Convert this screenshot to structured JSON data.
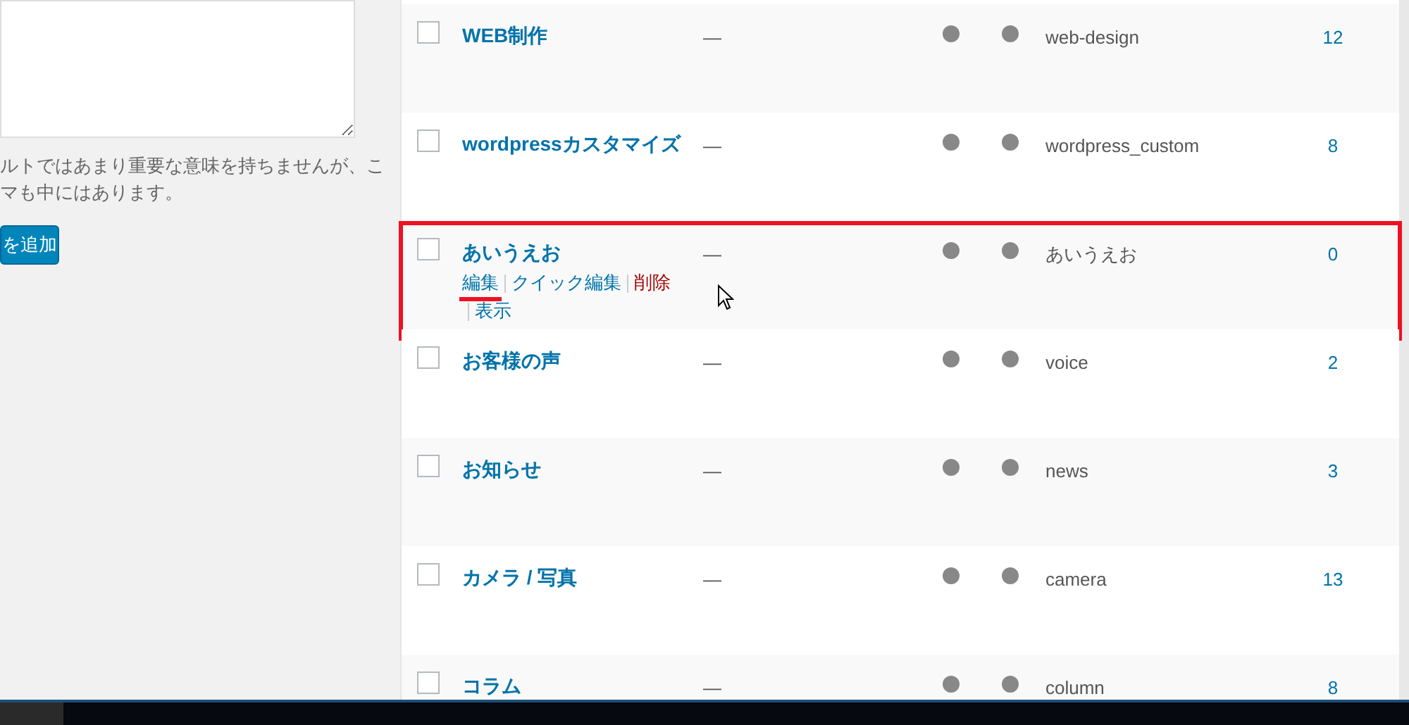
{
  "left_panel": {
    "help_lines": [
      "ルトではあまり重要な意味を持ちませんが、こ",
      "マも中にはあります。"
    ],
    "add_button": "を追加"
  },
  "table": {
    "rows": [
      {
        "name": "WEB制作",
        "description": "—",
        "slug": "web-design",
        "count": "12",
        "checked": false,
        "highlighted": false
      },
      {
        "name": "wordpressカスタマイズ",
        "description": "—",
        "slug": "wordpress_custom",
        "count": "8",
        "checked": false,
        "highlighted": false
      },
      {
        "name": "あいうえお",
        "description": "—",
        "slug": "あいうえお",
        "count": "0",
        "checked": false,
        "highlighted": true,
        "actions": [
          {
            "label": "編集",
            "kind": "edit",
            "underlined": true
          },
          {
            "label": "クイック編集",
            "kind": "edit",
            "underlined": false
          },
          {
            "label": "削除",
            "kind": "delete",
            "underlined": false
          },
          {
            "label": "表示",
            "kind": "edit",
            "underlined": false
          }
        ]
      },
      {
        "name": "お客様の声",
        "description": "—",
        "slug": "voice",
        "count": "2",
        "checked": false,
        "highlighted": false
      },
      {
        "name": "お知らせ",
        "description": "—",
        "slug": "news",
        "count": "3",
        "checked": false,
        "highlighted": false
      },
      {
        "name": "カメラ / 写真",
        "description": "—",
        "slug": "camera",
        "count": "13",
        "checked": false,
        "highlighted": false
      },
      {
        "name": "コラム",
        "description": "—",
        "slug": "column",
        "count": "8",
        "checked": false,
        "highlighted": false
      }
    ]
  }
}
